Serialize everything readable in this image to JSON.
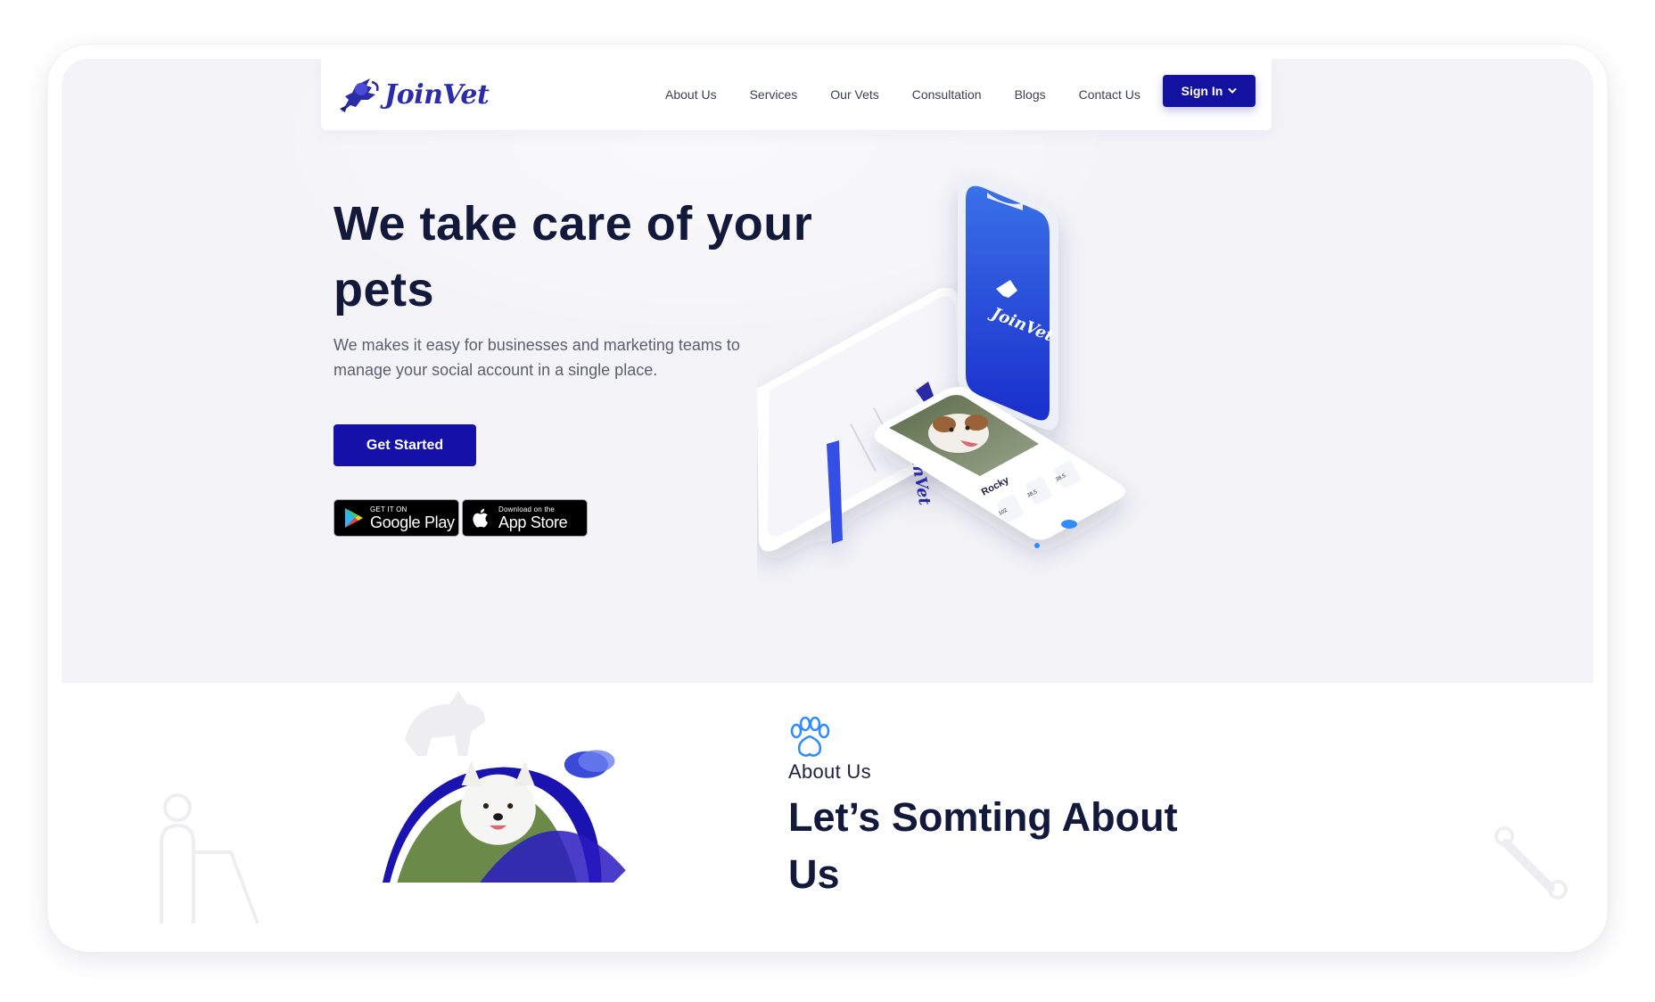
{
  "brand": {
    "name": "JoinVet",
    "accent": "#13119f"
  },
  "nav": {
    "links": [
      "About Us",
      "Services",
      "Our Vets",
      "Consultation",
      "Blogs",
      "Contact Us"
    ],
    "signin_label": "Sign In",
    "signin_icon": "chevron-down-icon"
  },
  "hero": {
    "title": "We take care of your pets",
    "subtitle": "We makes it easy for businesses and marketing teams to manage your social account in a single place.",
    "cta_label": "Get Started",
    "google_play": {
      "small": "GET IT ON",
      "big": "Google Play"
    },
    "app_store": {
      "small": "Download on the",
      "big": "App Store"
    }
  },
  "phones": {
    "phone_brand": "JoinVet",
    "pet_name": "Rocky",
    "stats": [
      "102",
      "38.5",
      "38.5"
    ]
  },
  "about": {
    "label": "About Us",
    "heading": "Let’s Somting About Us",
    "icon": "paw-icon"
  }
}
